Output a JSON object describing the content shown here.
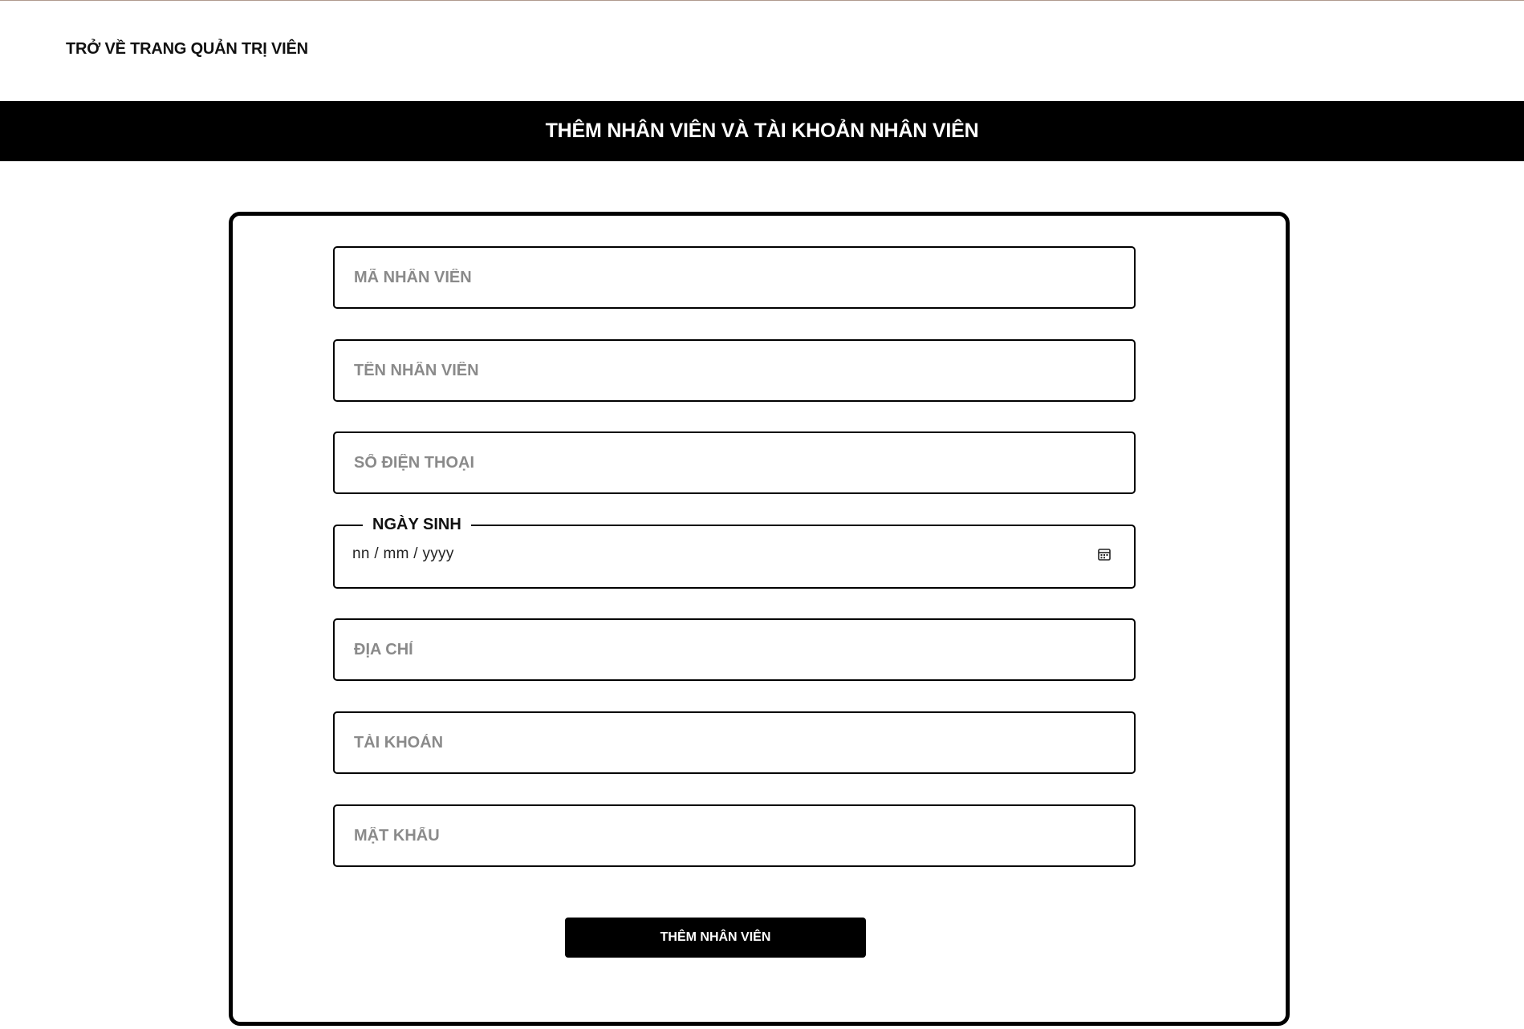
{
  "header": {
    "back_link": "TRỞ VỀ TRANG QUẢN TRỊ VIÊN"
  },
  "page_title": "THÊM NHÂN VIÊN VÀ TÀI KHOẢN NHÂN VIÊN",
  "form": {
    "employee_id": {
      "placeholder": "MÃ NHÂN VIÊN",
      "value": ""
    },
    "employee_name": {
      "placeholder": "TÊN NHÂN VIÊN",
      "value": ""
    },
    "phone": {
      "placeholder": "SỐ ĐIỆN THOẠI",
      "value": ""
    },
    "birth_date": {
      "label": "NGÀY SINH",
      "format_hint": "nn / mm / yyyy",
      "icon": "calendar-icon"
    },
    "address": {
      "placeholder": "ĐỊA CHỈ",
      "value": ""
    },
    "account": {
      "placeholder": "TÀI KHOẢN",
      "value": ""
    },
    "password": {
      "placeholder": "MẬT KHẨU",
      "value": ""
    },
    "submit_label": "THÊM NHÂN VIÊN"
  },
  "colors": {
    "title_bar": "#000000",
    "placeholder": "#8a8a8a",
    "button": "#000000"
  }
}
